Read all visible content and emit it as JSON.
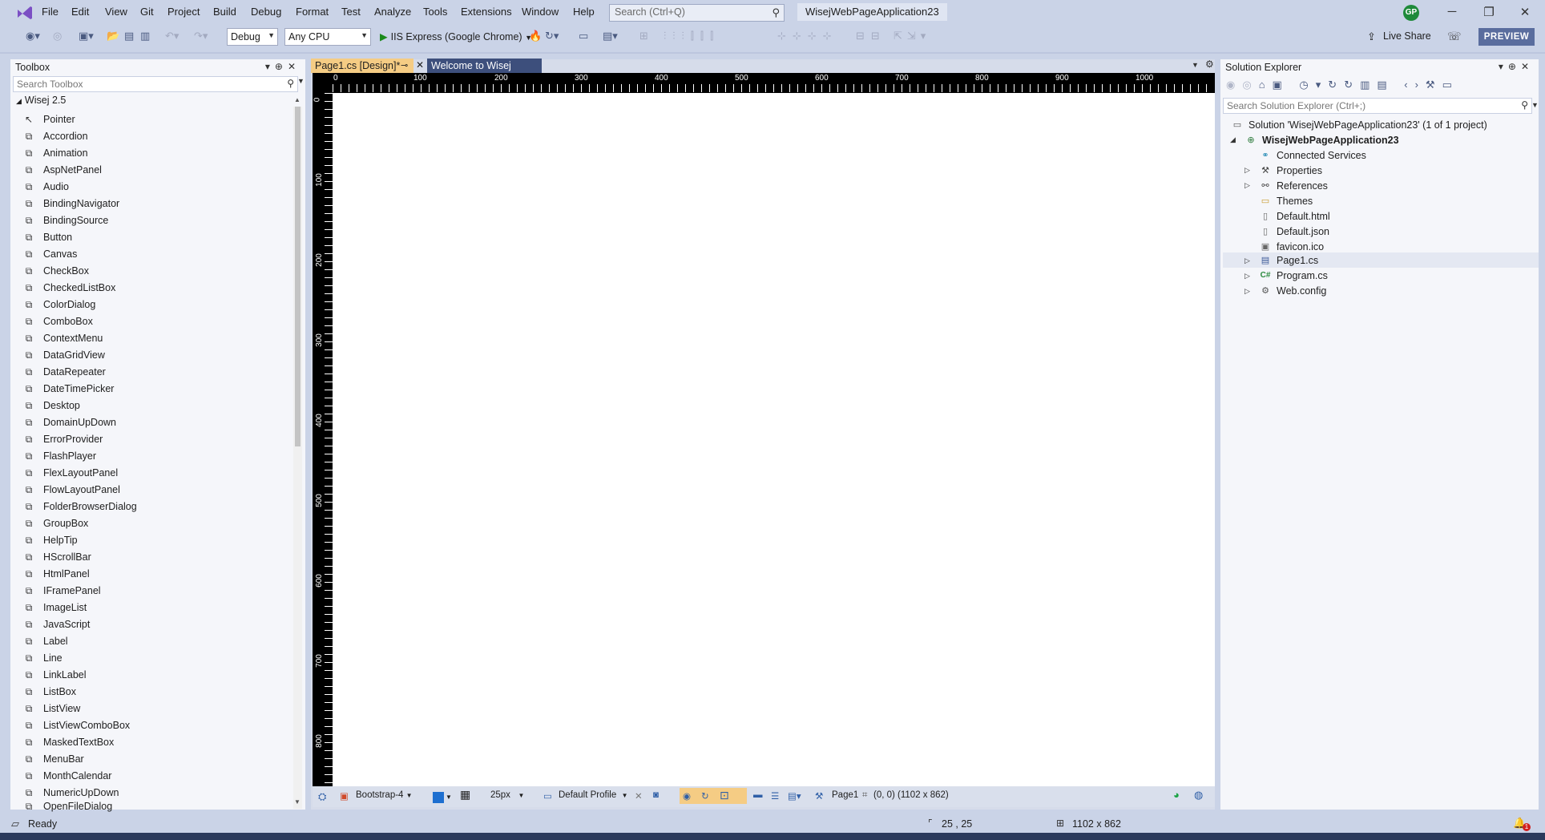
{
  "menu": [
    "File",
    "Edit",
    "View",
    "Git",
    "Project",
    "Build",
    "Debug",
    "Format",
    "Test",
    "Analyze",
    "Tools",
    "Extensions",
    "Window",
    "Help"
  ],
  "search": {
    "placeholder": "Search (Ctrl+Q)"
  },
  "solution_name": "WisejWebPageApplication23",
  "user_initials": "GP",
  "toolbar": {
    "config": "Debug",
    "platform": "Any CPU",
    "run_label": "IIS Express (Google Chrome)",
    "live_share": "Live Share",
    "preview": "PREVIEW"
  },
  "toolbox": {
    "title": "Toolbox",
    "search_placeholder": "Search Toolbox",
    "group": "Wisej 2.5",
    "items": [
      "Pointer",
      "Accordion",
      "Animation",
      "AspNetPanel",
      "Audio",
      "BindingNavigator",
      "BindingSource",
      "Button",
      "Canvas",
      "CheckBox",
      "CheckedListBox",
      "ColorDialog",
      "ComboBox",
      "ContextMenu",
      "DataGridView",
      "DataRepeater",
      "DateTimePicker",
      "Desktop",
      "DomainUpDown",
      "ErrorProvider",
      "FlashPlayer",
      "FlexLayoutPanel",
      "FlowLayoutPanel",
      "FolderBrowserDialog",
      "GroupBox",
      "HelpTip",
      "HScrollBar",
      "HtmlPanel",
      "IFramePanel",
      "ImageList",
      "JavaScript",
      "Label",
      "Line",
      "LinkLabel",
      "ListBox",
      "ListView",
      "ListViewComboBox",
      "MaskedTextBox",
      "MenuBar",
      "MonthCalendar",
      "NumericUpDown",
      "OpenFileDialog"
    ]
  },
  "tabs": [
    {
      "label": "Page1.cs [Design]*"
    },
    {
      "label": "Welcome to Wisej"
    }
  ],
  "ruler": {
    "top": [
      "0",
      "100",
      "200",
      "300",
      "400",
      "500",
      "600",
      "700",
      "800",
      "900",
      "1000"
    ],
    "left": [
      "0",
      "100",
      "200",
      "300",
      "400",
      "500",
      "600",
      "700",
      "800"
    ]
  },
  "design_bar": {
    "theme": "Bootstrap-4",
    "grid_size": "25px",
    "profile": "Default Profile",
    "page": "Page1",
    "bounds": "(0, 0) (1102 x 862)"
  },
  "solution_explorer": {
    "title": "Solution Explorer",
    "search_placeholder": "Search Solution Explorer (Ctrl+;)",
    "solution_label": "Solution 'WisejWebPageApplication23' (1 of 1 project)",
    "project": "WisejWebPageApplication23",
    "items": [
      "Connected Services",
      "Properties",
      "References",
      "Themes",
      "Default.html",
      "Default.json",
      "favicon.ico",
      "Page1.cs",
      "Program.cs",
      "Web.config"
    ]
  },
  "status": {
    "text": "Ready",
    "position": "25 , 25",
    "size": "1102 x 862",
    "notifications": "1"
  }
}
